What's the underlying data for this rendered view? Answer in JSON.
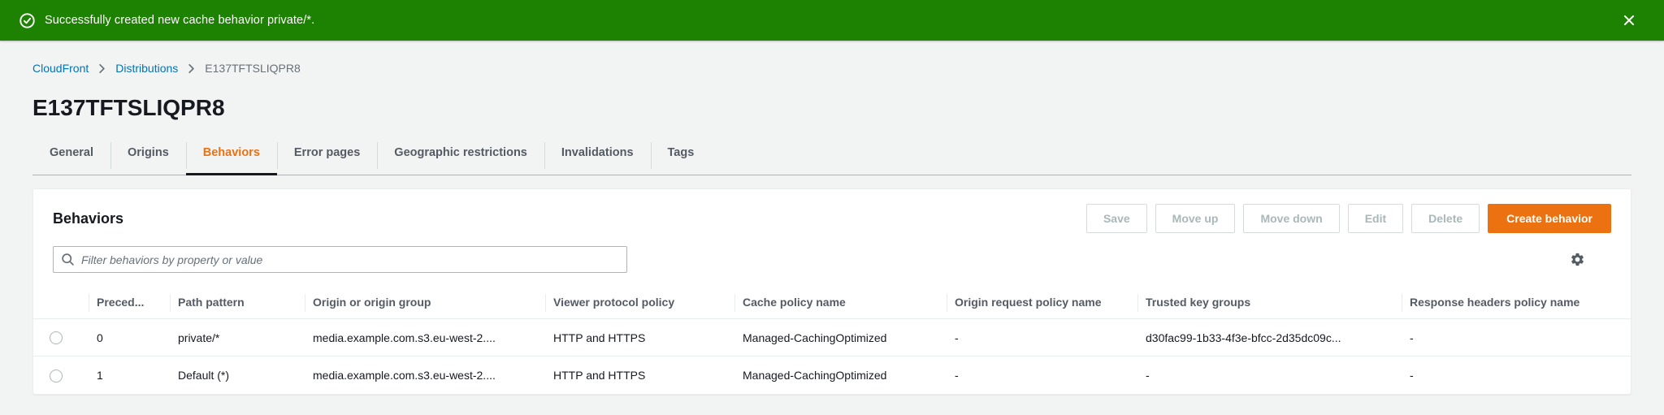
{
  "flashbar": {
    "message": "Successfully created new cache behavior private/*."
  },
  "breadcrumb": {
    "items": [
      {
        "label": "CloudFront"
      },
      {
        "label": "Distributions"
      },
      {
        "label": "E137TFTSLIQPR8"
      }
    ]
  },
  "page": {
    "title": "E137TFTSLIQPR8"
  },
  "tabs": [
    {
      "label": "General"
    },
    {
      "label": "Origins"
    },
    {
      "label": "Behaviors",
      "active": true
    },
    {
      "label": "Error pages"
    },
    {
      "label": "Geographic restrictions"
    },
    {
      "label": "Invalidations"
    },
    {
      "label": "Tags"
    }
  ],
  "panel": {
    "title": "Behaviors",
    "actions": {
      "save": "Save",
      "move_up": "Move up",
      "move_down": "Move down",
      "edit": "Edit",
      "delete": "Delete",
      "create": "Create behavior"
    },
    "filter": {
      "placeholder": "Filter behaviors by property or value"
    }
  },
  "table": {
    "columns": [
      "Preced...",
      "Path pattern",
      "Origin or origin group",
      "Viewer protocol policy",
      "Cache policy name",
      "Origin request policy name",
      "Trusted key groups",
      "Response headers policy name"
    ],
    "rows": [
      {
        "precedence": "0",
        "path_pattern": "private/*",
        "origin": "media.example.com.s3.eu-west-2....",
        "viewer_protocol": "HTTP and HTTPS",
        "cache_policy": "Managed-CachingOptimized",
        "origin_request_policy": "-",
        "trusted_key_groups": "d30fac99-1b33-4f3e-bfcc-2d35dc09c...",
        "response_headers_policy": "-"
      },
      {
        "precedence": "1",
        "path_pattern": "Default (*)",
        "origin": "media.example.com.s3.eu-west-2....",
        "viewer_protocol": "HTTP and HTTPS",
        "cache_policy": "Managed-CachingOptimized",
        "origin_request_policy": "-",
        "trusted_key_groups": "-",
        "response_headers_policy": "-"
      }
    ]
  },
  "icons": {
    "flash_status": "check-circle",
    "flash_dismiss": "close-x",
    "breadcrumb_separator": "chevron-right",
    "filter": "search-magnifier",
    "table_settings": "gear"
  },
  "colors": {
    "success_green": "#1d8102",
    "accent_orange": "#ec7211",
    "link_blue": "#0073bb",
    "page_background": "#f2f3f3"
  }
}
